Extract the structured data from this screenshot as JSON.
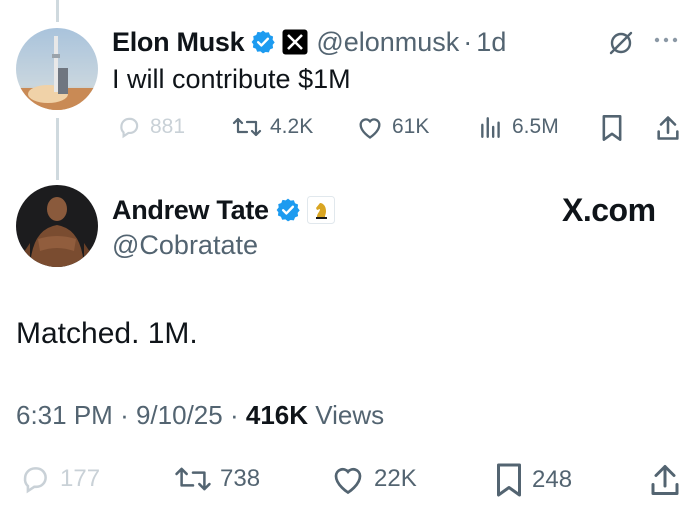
{
  "reply_tweet": {
    "author_name": "Elon Musk",
    "handle": "@elonmusk",
    "separator": "·",
    "time_ago": "1d",
    "text": "I will contribute $1M",
    "stats": {
      "replies": "881",
      "retweets": "4.2K",
      "likes": "61K",
      "views": "6.5M"
    }
  },
  "main_tweet": {
    "author_name": "Andrew Tate",
    "handle": "@Cobratate",
    "brand_watermark": "X.com",
    "text": "Matched. 1M.",
    "time": "6:31 PM",
    "date": "9/10/25",
    "separator1": "·",
    "separator2": "·",
    "views_count": "416K",
    "views_label": "Views",
    "stats": {
      "replies": "177",
      "retweets": "738",
      "likes": "22K",
      "bookmarks": "248"
    }
  },
  "icons": [
    "verified-badge",
    "x-logo-badge",
    "knight-badge",
    "grok-icon",
    "more-icon",
    "reply-icon",
    "retweet-icon",
    "like-icon",
    "views-icon",
    "bookmark-icon",
    "share-icon"
  ],
  "colors": {
    "text": "#0f1419",
    "muted": "#536471",
    "verified": "#1d9bf0",
    "thread_line": "#cfd9de",
    "faded": "#c9d1d7"
  }
}
